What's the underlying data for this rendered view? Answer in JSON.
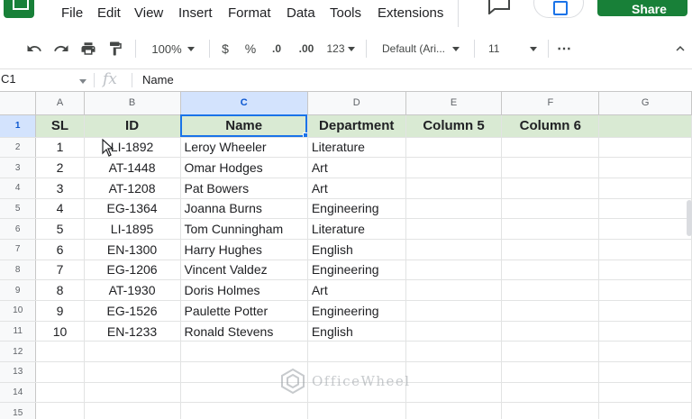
{
  "menu": {
    "items": [
      "File",
      "Edit",
      "View",
      "Insert",
      "Format",
      "Data",
      "Tools",
      "Extensions"
    ],
    "share_label": "Share"
  },
  "toolbar": {
    "zoom": "100%",
    "currency": "$",
    "percent": "%",
    "decimal_decrease": ".0",
    "decimal_increase": ".00",
    "more_formats": "123",
    "font": "Default (Ari...",
    "font_size": "11",
    "more": "⋯"
  },
  "formula_bar": {
    "name_box": "C1",
    "fx": "fx",
    "value": "Name"
  },
  "grid": {
    "columns": [
      "A",
      "B",
      "C",
      "D",
      "E",
      "F",
      "G"
    ],
    "selected_column": "C",
    "selected_row": "1",
    "header_row": [
      "SL",
      "ID",
      "Name",
      "Department",
      "Column 5",
      "Column 6",
      ""
    ],
    "rows": [
      [
        "1",
        "LI-1892",
        "Leroy Wheeler",
        "Literature"
      ],
      [
        "2",
        "AT-1448",
        "Omar Hodges",
        "Art"
      ],
      [
        "3",
        "AT-1208",
        "Pat Bowers",
        "Art"
      ],
      [
        "4",
        "EG-1364",
        "Joanna Burns",
        "Engineering"
      ],
      [
        "5",
        "LI-1895",
        "Tom Cunningham",
        "Literature"
      ],
      [
        "6",
        "EN-1300",
        "Harry Hughes",
        "English"
      ],
      [
        "7",
        "EG-1206",
        "Vincent Valdez",
        "Engineering"
      ],
      [
        "8",
        "AT-1930",
        "Doris Holmes",
        "Art"
      ],
      [
        "9",
        "EG-1526",
        "Paulette Potter",
        "Engineering"
      ],
      [
        "10",
        "EN-1233",
        "Ronald Stevens",
        "English"
      ]
    ],
    "row_numbers": [
      "1",
      "2",
      "3",
      "4",
      "5",
      "6",
      "7",
      "8",
      "9",
      "10",
      "11",
      "12",
      "13",
      "14",
      "15"
    ]
  },
  "watermark": "OfficeWheel",
  "colors": {
    "header_fill": "#d9ead3",
    "selection": "#1a73e8",
    "brand_green": "#188038"
  }
}
